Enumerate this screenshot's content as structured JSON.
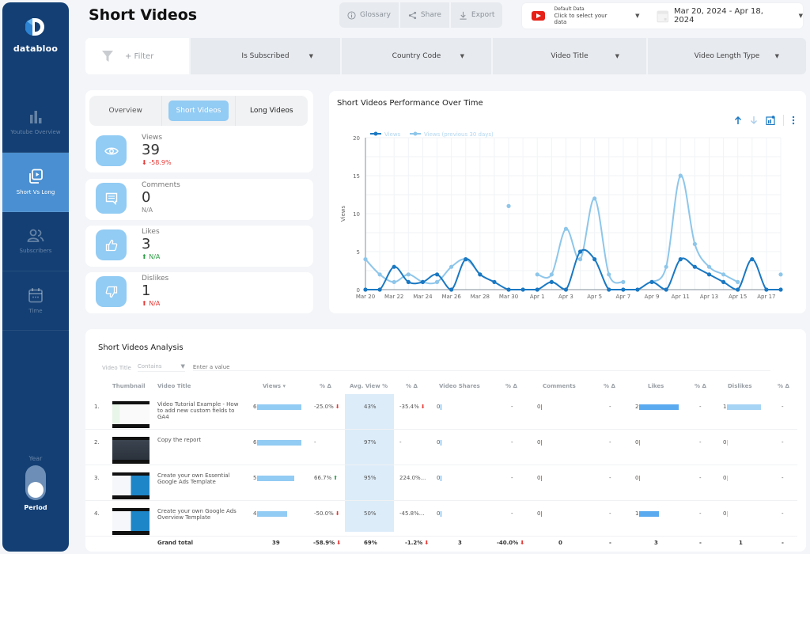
{
  "brand": {
    "name": "databloo"
  },
  "sidebar": {
    "items": [
      {
        "label": "Youtube Overview",
        "icon": "bar-chart-icon",
        "active": false
      },
      {
        "label": "Short Vs Long",
        "icon": "video-library-icon",
        "active": true
      },
      {
        "label": "Subscribers",
        "icon": "people-icon",
        "active": false
      },
      {
        "label": "Time",
        "icon": "calendar-icon",
        "active": false
      }
    ],
    "toggle": {
      "top_label": "Year",
      "bottom_label": "Period",
      "state": "Period"
    }
  },
  "header": {
    "title": "Short Videos",
    "actions": [
      {
        "label": "Glossary",
        "icon": "info-icon"
      },
      {
        "label": "Share",
        "icon": "share-icon"
      },
      {
        "label": "Export",
        "icon": "download-icon"
      }
    ],
    "data_source": {
      "line1": "Default Data",
      "line2": "Click to select your data"
    },
    "date_range": "Mar 20, 2024 - Apr 18, 2024"
  },
  "filters": {
    "add_label": "+ Filter",
    "items": [
      "Is Subscribed",
      "Country Code",
      "Video Title",
      "Video Length Type"
    ]
  },
  "tabs": [
    {
      "label": "Overview",
      "active": false
    },
    {
      "label": "Short Videos",
      "active": true
    },
    {
      "label": "Long Videos",
      "active": false
    }
  ],
  "kpis": [
    {
      "label": "Views",
      "value": "39",
      "delta": "-58.9%",
      "trend": "down",
      "icon": "eye-icon"
    },
    {
      "label": "Comments",
      "value": "0",
      "delta": "N/A",
      "trend": "none",
      "icon": "comment-icon"
    },
    {
      "label": "Likes",
      "value": "3",
      "delta": "N/A",
      "trend": "up",
      "icon": "thumbs-up-icon"
    },
    {
      "label": "Dislikes",
      "value": "1",
      "delta": "N/A",
      "trend": "up-bad",
      "icon": "thumbs-down-icon"
    }
  ],
  "chart": {
    "title": "Short Videos Performance Over Time"
  },
  "chart_data": {
    "type": "line",
    "title": "Short Videos Performance Over Time",
    "xlabel": "",
    "ylabel": "Views",
    "ylim": [
      0,
      20
    ],
    "yticks": [
      0,
      5,
      10,
      15,
      20
    ],
    "grid": true,
    "legend": "top-left",
    "x": [
      "Mar 20",
      "Mar 21",
      "Mar 22",
      "Mar 23",
      "Mar 24",
      "Mar 25",
      "Mar 26",
      "Mar 27",
      "Mar 28",
      "Mar 29",
      "Mar 30",
      "Mar 31",
      "Apr 1",
      "Apr 2",
      "Apr 3",
      "Apr 4",
      "Apr 5",
      "Apr 6",
      "Apr 7",
      "Apr 8",
      "Apr 9",
      "Apr 10",
      "Apr 11",
      "Apr 12",
      "Apr 13",
      "Apr 14",
      "Apr 15",
      "Apr 16",
      "Apr 17",
      "Apr 18"
    ],
    "xtick_labels": [
      "Mar 20",
      "Mar 22",
      "Mar 24",
      "Mar 26",
      "Mar 28",
      "Mar 30",
      "Apr 1",
      "Apr 3",
      "Apr 5",
      "Apr 7",
      "Apr 9",
      "Apr 11",
      "Apr 13",
      "Apr 15",
      "Apr 17"
    ],
    "series": [
      {
        "name": "Views",
        "color": "#1a78c2",
        "values": [
          0,
          0,
          3,
          1,
          1,
          2,
          0,
          4,
          2,
          1,
          0,
          0,
          0,
          1,
          0,
          5,
          4,
          0,
          0,
          0,
          1,
          0,
          4,
          3,
          2,
          1,
          0,
          4,
          0,
          0
        ]
      },
      {
        "name": "Views (previous 30 days)",
        "color": "#8ec6ea",
        "values": [
          4,
          2,
          1,
          2,
          1,
          1,
          3,
          4,
          2,
          null,
          11,
          null,
          2,
          2,
          8,
          4,
          12,
          2,
          1,
          null,
          1,
          3,
          15,
          6,
          3,
          2,
          1,
          null,
          null,
          2
        ]
      }
    ]
  },
  "table": {
    "title": "Short Videos Analysis",
    "filter": {
      "field": "Video Title",
      "operator": "Contains",
      "placeholder": "Enter a value"
    },
    "columns": [
      "Thumbnail",
      "Video Title",
      "Views",
      "% Δ",
      "Avg. View %",
      "% Δ",
      "Video Shares",
      "% Δ",
      "Comments",
      "% Δ",
      "Likes",
      "% Δ",
      "Dislikes",
      "% Δ"
    ],
    "sort_indicator": "▾",
    "rows": [
      {
        "rank": "1.",
        "title": "Video Tutorial Example - How to add new custom fields to GA4",
        "views": 6,
        "views_delta": "-25.0%",
        "views_trend": "down",
        "avg_view": "43%",
        "avg_delta": "-35.4%",
        "avg_trend": "down",
        "shares": 0,
        "shares_delta": "-",
        "comments": 0,
        "comments_delta": "-",
        "likes": 2,
        "likes_delta": "-",
        "dislikes": 1,
        "dislikes_delta": "-"
      },
      {
        "rank": "2.",
        "title": "Copy the report",
        "views": 6,
        "views_delta": "-",
        "views_trend": "none",
        "avg_view": "97%",
        "avg_delta": "-",
        "avg_trend": "none",
        "shares": 0,
        "shares_delta": "-",
        "comments": 0,
        "comments_delta": "-",
        "likes": 0,
        "likes_delta": "-",
        "dislikes": 0,
        "dislikes_delta": "-"
      },
      {
        "rank": "3.",
        "title": "Create your own Essential Google Ads Template",
        "views": 5,
        "views_delta": "66.7%",
        "views_trend": "up",
        "avg_view": "95%",
        "avg_delta": "224.0%...",
        "avg_trend": "none",
        "shares": 0,
        "shares_delta": "-",
        "comments": 0,
        "comments_delta": "-",
        "likes": 0,
        "likes_delta": "-",
        "dislikes": 0,
        "dislikes_delta": "-"
      },
      {
        "rank": "4.",
        "title": "Create your own Google Ads Overview Template",
        "views": 4,
        "views_delta": "-50.0%",
        "views_trend": "down",
        "avg_view": "50%",
        "avg_delta": "-45.8%...",
        "avg_trend": "none",
        "shares": 0,
        "shares_delta": "-",
        "comments": 0,
        "comments_delta": "-",
        "likes": 1,
        "likes_delta": "-",
        "dislikes": 0,
        "dislikes_delta": "-"
      }
    ],
    "total": {
      "label": "Grand total",
      "views": "39",
      "views_delta": "-58.9%",
      "avg_view": "69%",
      "avg_delta": "-1.2%",
      "shares": "3",
      "shares_delta": "-40.0%",
      "comments": "0",
      "comments_delta": "-",
      "likes": "3",
      "likes_delta": "-",
      "dislikes": "1",
      "dislikes_delta": "-"
    }
  }
}
